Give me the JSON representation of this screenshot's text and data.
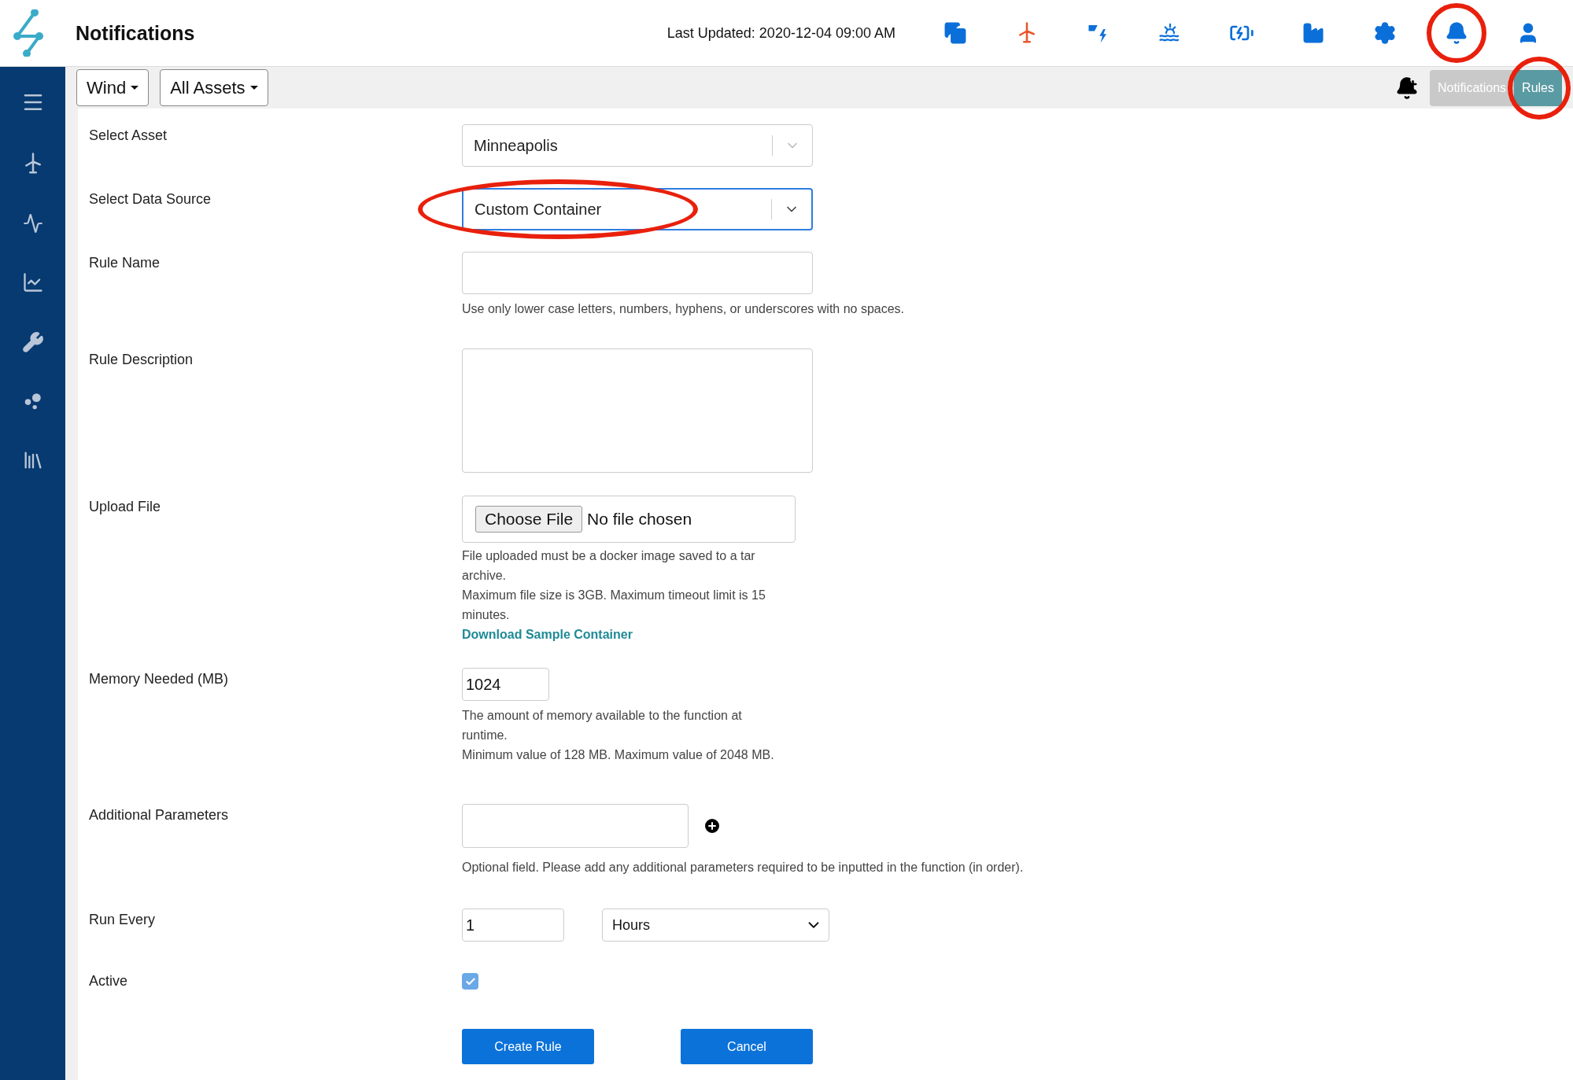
{
  "header": {
    "title": "Notifications",
    "last_updated": "Last Updated: 2020-12-04 09:00 AM",
    "nav_icons": [
      {
        "selected": false,
        "annotated": false
      },
      {
        "selected": true,
        "annotated": false
      },
      {
        "selected": false,
        "annotated": false
      },
      {
        "selected": false,
        "annotated": false
      },
      {
        "selected": false,
        "annotated": false
      },
      {
        "selected": false,
        "annotated": false
      },
      {
        "selected": false,
        "annotated": false
      },
      {
        "selected": false,
        "annotated": true
      },
      {
        "selected": false,
        "annotated": false
      }
    ]
  },
  "filters": [
    "Wind",
    "All Assets"
  ],
  "view_toggle": [
    {
      "label": "Notifications",
      "selected": false,
      "annotated": false
    },
    {
      "label": "Rules",
      "selected": true,
      "annotated": true
    }
  ],
  "form": [
    {
      "kind": "select",
      "label": "Select Asset",
      "value": "Minneapolis",
      "focused": false,
      "annotated": false
    },
    {
      "kind": "select",
      "label": "Select Data Source",
      "value": "Custom Container",
      "focused": true,
      "annotated": true
    },
    {
      "kind": "text",
      "label": "Rule Name",
      "hints": [
        "Use only lower case letters, numbers, hyphens, or underscores with no spaces."
      ]
    },
    {
      "kind": "textarea",
      "label": "Rule Description"
    },
    {
      "kind": "file",
      "label": "Upload File",
      "button": "Choose File",
      "status": "No file chosen",
      "hints": [
        "File uploaded must be a docker image saved to a tar archive.",
        "Maximum file size is 3GB. Maximum timeout limit is 15 minutes."
      ],
      "link": "Download Sample Container"
    },
    {
      "kind": "number",
      "label": "Memory Needed (MB)",
      "value": "1024",
      "hints": [
        "The amount of memory available to the function at runtime.",
        "Minimum value of 128 MB. Maximum value of 2048 MB."
      ]
    },
    {
      "kind": "params",
      "label": "Additional Parameters",
      "hints": [
        "Optional field. Please add any additional parameters required to be inputted in the function (in order)."
      ]
    },
    {
      "kind": "interval",
      "label": "Run Every",
      "value": "1",
      "unit": "Hours"
    },
    {
      "kind": "checkbox",
      "label": "Active",
      "checked": true
    }
  ],
  "buttons": [
    "Create Rule",
    "Cancel"
  ]
}
